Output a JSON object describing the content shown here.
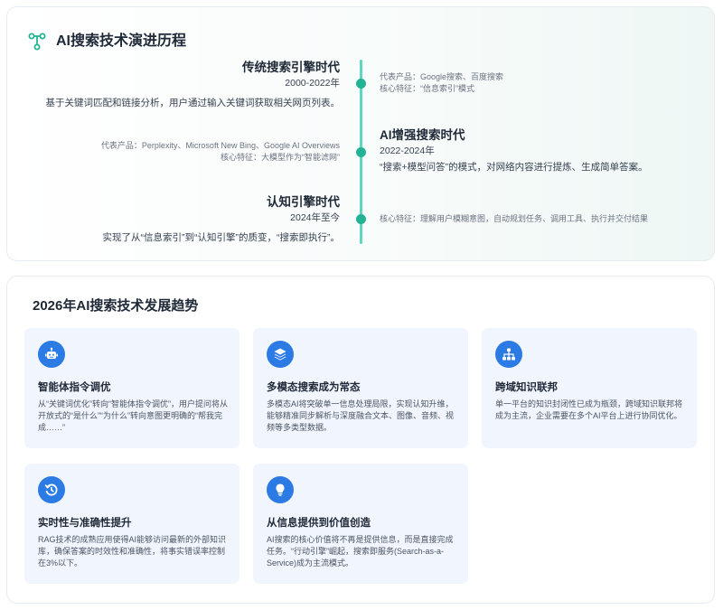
{
  "timeline": {
    "title": "AI搜索技术演进历程",
    "eras": [
      {
        "title": "传统搜索引擎时代",
        "date": "2000-2022年",
        "desc": "基于关键词匹配和链接分析，用户通过输入关键词获取相关网页列表。",
        "meta": [
          "代表产品：Google搜索、百度搜索",
          "核心特征：“信息索引”模式"
        ]
      },
      {
        "title": "AI增强搜索时代",
        "date": "2022-2024年",
        "desc": "“搜索+模型问答”的模式，对网络内容进行提炼、生成简单答案。",
        "meta": [
          "代表产品：Perplexity、Microsoft New Bing、Google AI Overviews",
          "核心特征：大模型作为“智能滤网”"
        ]
      },
      {
        "title": "认知引擎时代",
        "date": "2024年至今",
        "desc": "实现了从“信息索引”到“认知引擎”的质变，“搜索即执行”。",
        "meta": [
          "核心特征：理解用户模糊意图，自动规划任务、调用工具、执行并交付结果"
        ]
      }
    ]
  },
  "trends": {
    "title": "2026年AI搜索技术发展趋势",
    "accent_color": "#2c7be5",
    "cards": [
      {
        "icon": "robot-icon",
        "title": "智能体指令调优",
        "desc": "从“关键词优化”转向“智能体指令调优”，用户提问将从开放式的“是什么”“为什么”转向意图更明确的“帮我完成……”"
      },
      {
        "icon": "layers-icon",
        "title": "多模态搜索成为常态",
        "desc": "多模态AI将突破单一信息处理局限，实现认知升维，能够精准同步解析与深度融合文本、图像、音频、视频等多类型数据。"
      },
      {
        "icon": "hierarchy-icon",
        "title": "跨域知识联邦",
        "desc": "单一平台的知识封闭性已成为瓶颈，跨域知识联邦将成为主流，企业需要在多个AI平台上进行协同优化。"
      },
      {
        "icon": "history-icon",
        "title": "实时性与准确性提升",
        "desc": "RAG技术的成熟应用使得AI能够访问最新的外部知识库，确保答案的时效性和准确性，将事实错误率控制在3%以下。"
      },
      {
        "icon": "lightbulb-icon",
        "title": "从信息提供到价值创造",
        "desc": "AI搜索的核心价值将不再是提供信息，而是直接完成任务。“行动引擎”崛起，搜索即服务(Search-as-a-Service)成为主流模式。"
      }
    ]
  }
}
